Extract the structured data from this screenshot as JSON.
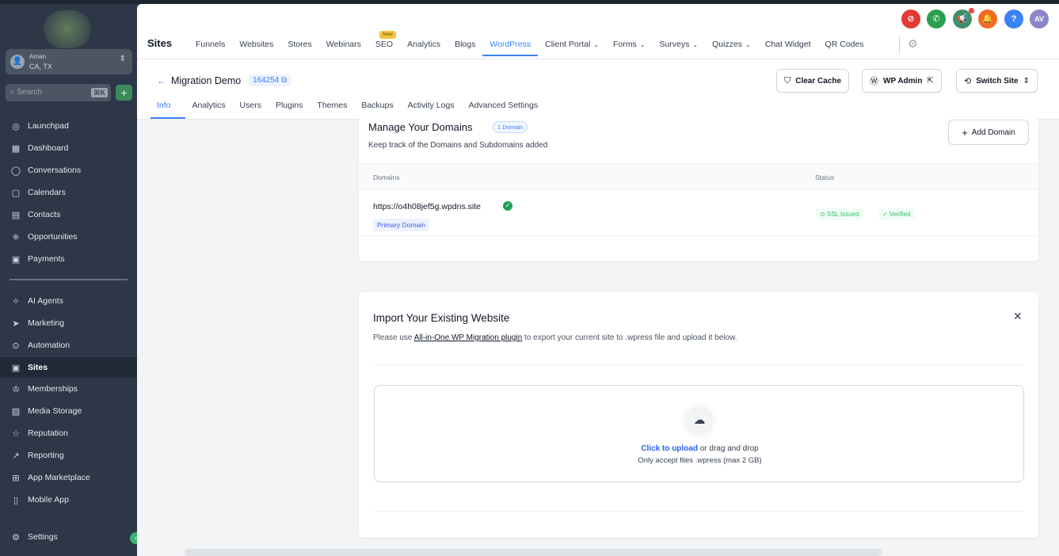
{
  "sidebar": {
    "account": {
      "name": "Aman",
      "location": "CA, TX",
      "avatar": "👤"
    },
    "search_placeholder": "Search",
    "search_shortcut": "⌘K",
    "plus": "+",
    "items": [
      {
        "label": "Launchpad",
        "icon": "◎"
      },
      {
        "label": "Dashboard",
        "icon": "▦"
      },
      {
        "label": "Conversations",
        "icon": "◯"
      },
      {
        "label": "Calendars",
        "icon": "▢"
      },
      {
        "label": "Contacts",
        "icon": "▤"
      },
      {
        "label": "Opportunities",
        "icon": "⁜"
      },
      {
        "label": "Payments",
        "icon": "▣"
      },
      {
        "label": "AI Agents",
        "icon": "✧"
      },
      {
        "label": "Marketing",
        "icon": "➤"
      },
      {
        "label": "Automation",
        "icon": "⊙"
      },
      {
        "label": "Sites",
        "icon": "▣"
      },
      {
        "label": "Memberships",
        "icon": "♔"
      },
      {
        "label": "Media Storage",
        "icon": "▨"
      },
      {
        "label": "Reputation",
        "icon": "☆"
      },
      {
        "label": "Reporting",
        "icon": "↗"
      },
      {
        "label": "App Marketplace",
        "icon": "⊞"
      },
      {
        "label": "Mobile App",
        "icon": "▯"
      },
      {
        "label": "Settings",
        "icon": "⚙"
      }
    ],
    "collapse": "‹"
  },
  "header": {
    "title": "Sites",
    "tabs": [
      {
        "label": "Funnels"
      },
      {
        "label": "Websites"
      },
      {
        "label": "Stores"
      },
      {
        "label": "Webinars"
      },
      {
        "label": "SEO"
      },
      {
        "label": "Analytics"
      },
      {
        "label": "Blogs"
      },
      {
        "label": "WordPress"
      },
      {
        "label": "Client Portal"
      },
      {
        "label": "Forms"
      },
      {
        "label": "Surveys"
      },
      {
        "label": "Quizzes"
      },
      {
        "label": "Chat Widget"
      },
      {
        "label": "QR Codes"
      }
    ],
    "new_badge": "New",
    "top_icons": [
      {
        "glyph": "⊘",
        "color": "#e53935"
      },
      {
        "glyph": "✆",
        "color": "#2e9e4f"
      },
      {
        "glyph": "📢",
        "color": "#3f8f6b"
      },
      {
        "glyph": "🔔",
        "color": "#f26b21"
      },
      {
        "glyph": "?",
        "color": "#3b82f6"
      },
      {
        "glyph": "AV",
        "color": "#8b86c9"
      }
    ]
  },
  "site": {
    "back": "←",
    "name": "Migration Demo",
    "id": "164254 ⧉",
    "actions": {
      "clear_cache": "Clear Cache",
      "wp_admin": "WP Admin",
      "switch_site": "Switch Site"
    },
    "subtabs": [
      "Info",
      "Analytics",
      "Users",
      "Plugins",
      "Themes",
      "Backups",
      "Activity Logs",
      "Advanced Settings"
    ]
  },
  "domains": {
    "title": "Manage Your Domains",
    "count": "1 Domain",
    "subtitle": "Keep track of the Domains and Subdomains added",
    "add_button": "Add Domain",
    "columns": {
      "domains": "Domains",
      "status": "Status"
    },
    "rows": [
      {
        "url": "https://o4h08jef5g.wpdns.site",
        "badge": "Primary Domain",
        "ssl": "⊙ SSL Issued",
        "verified": "✓ Verified"
      }
    ]
  },
  "import": {
    "title": "Import Your Existing Website",
    "close": "✕",
    "desc_prefix": "Please use ",
    "desc_link": "All-in-One WP Migration plugin",
    "desc_suffix": " to export your current site to .wpress file and upload it below.",
    "upload_link": "Click to upload",
    "upload_rest": " or drag and drop",
    "upload_note": "Only accept files .wpress (max 2 GB)"
  }
}
